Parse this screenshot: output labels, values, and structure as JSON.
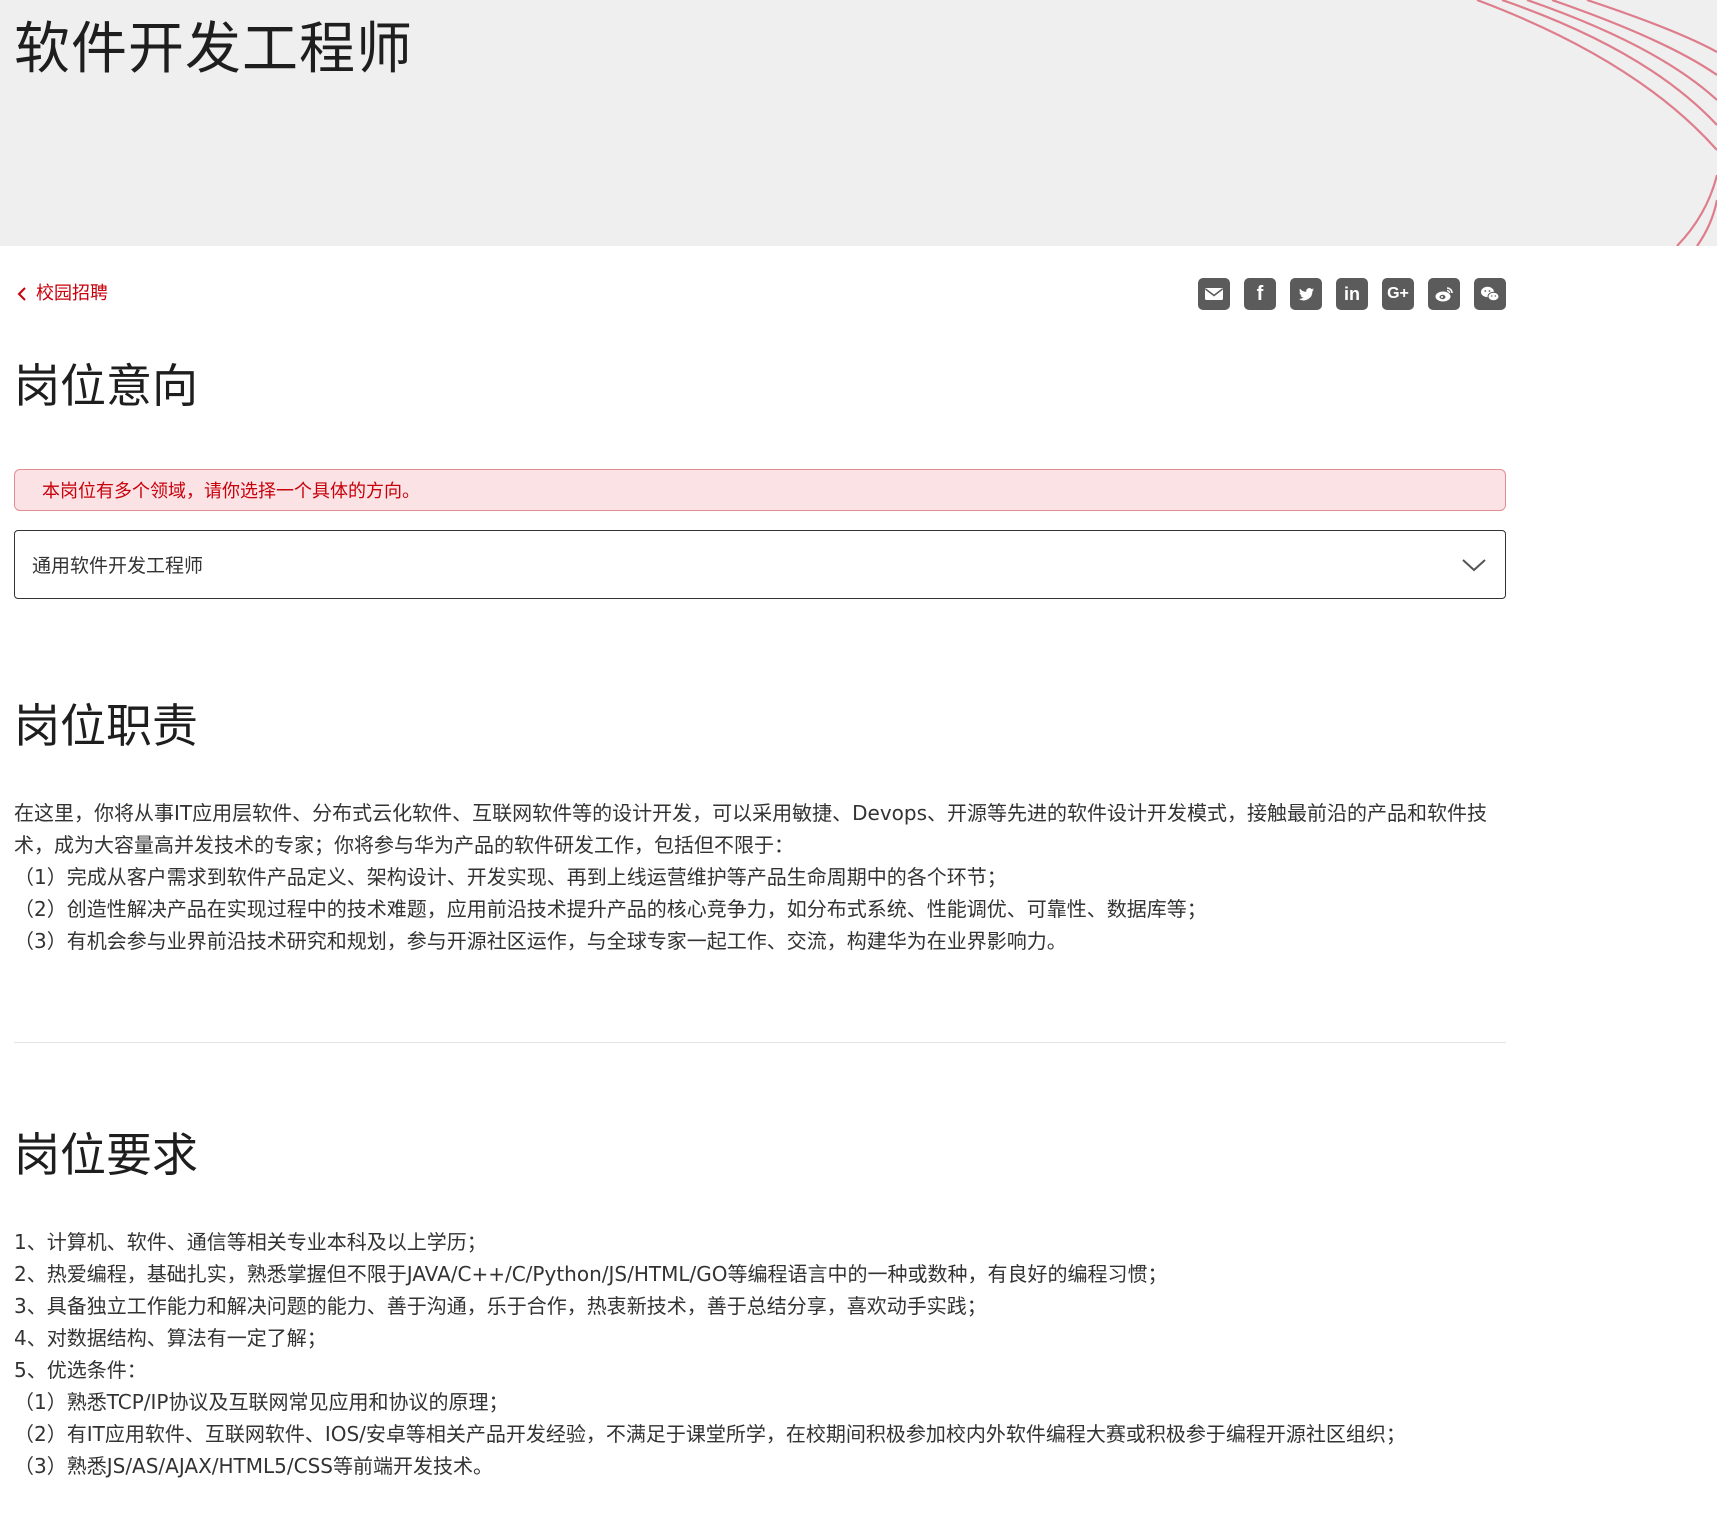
{
  "hero": {
    "title": "软件开发工程师"
  },
  "nav": {
    "back_label": "校园招聘"
  },
  "share": [
    {
      "name": "email-icon"
    },
    {
      "name": "facebook-icon",
      "glyph": "f"
    },
    {
      "name": "twitter-icon"
    },
    {
      "name": "linkedin-icon",
      "glyph": "in"
    },
    {
      "name": "google-plus-icon",
      "glyph": "G+"
    },
    {
      "name": "weibo-icon"
    },
    {
      "name": "wechat-icon"
    }
  ],
  "intent": {
    "heading": "岗位意向",
    "notice": "本岗位有多个领域，请你选择一个具体的方向。",
    "selected_direction": "通用软件开发工程师"
  },
  "duties": {
    "heading": "岗位职责",
    "paragraphs": [
      "在这里，你将从事IT应用层软件、分布式云化软件、互联网软件等的设计开发，可以采用敏捷、Devops、开源等先进的软件设计开发模式，接触最前沿的产品和软件技术，成为大容量高并发技术的专家；你将参与华为产品的软件研发工作，包括但不限于：",
      "（1）完成从客户需求到软件产品定义、架构设计、开发实现、再到上线运营维护等产品生命周期中的各个环节；",
      "（2）创造性解决产品在实现过程中的技术难题，应用前沿技术提升产品的核心竞争力，如分布式系统、性能调优、可靠性、数据库等；",
      "（3）有机会参与业界前沿技术研究和规划，参与开源社区运作，与全球专家一起工作、交流，构建华为在业界影响力。"
    ]
  },
  "requirements": {
    "heading": "岗位要求",
    "paragraphs": [
      "1、计算机、软件、通信等相关专业本科及以上学历；",
      "2、热爱编程，基础扎实，熟悉掌握但不限于JAVA/C++/C/Python/JS/HTML/GO等编程语言中的一种或数种，有良好的编程习惯；",
      "3、具备独立工作能力和解决问题的能力、善于沟通，乐于合作，热衷新技术，善于总结分享，喜欢动手实践；",
      "4、对数据结构、算法有一定了解；",
      "5、优选条件：",
      "（1）熟悉TCP/IP协议及互联网常见应用和协议的原理；",
      "（2）有IT应用软件、互联网软件、IOS/安卓等相关产品开发经验，不满足于课堂所学，在校期间积极参加校内外软件编程大赛或积极参于编程开源社区组织；",
      "（3）熟悉JS/AS/AJAX/HTML5/CSS等前端开发技术。"
    ]
  },
  "colors": {
    "accent": "#c7000b",
    "notice_bg": "#fbe3e5",
    "hero_bg": "#efefef",
    "icon_bg": "#5b5b5b"
  }
}
